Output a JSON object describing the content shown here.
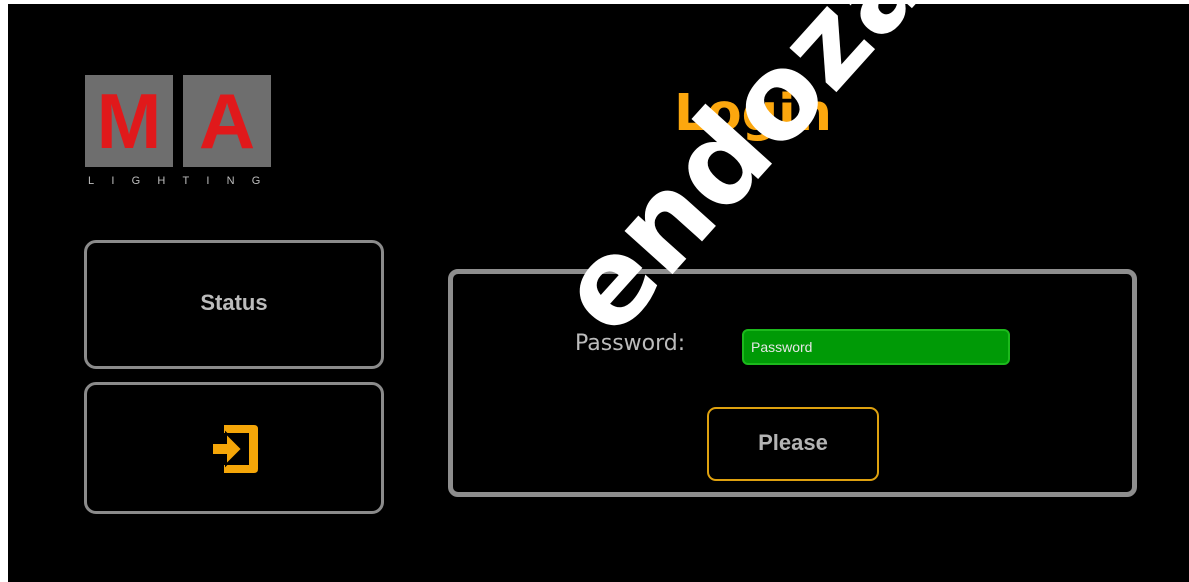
{
  "logo": {
    "letter_1": "M",
    "letter_2": "A",
    "subtitle": "LIGHTING",
    "colors": {
      "box": "#6e6e6e",
      "letters": "#e0191b"
    }
  },
  "header": {
    "title": "Login"
  },
  "sidebar": {
    "status_label": "Status",
    "login_icon": "login-arrow-icon"
  },
  "login_form": {
    "password_label": "Password:",
    "password_placeholder": "Password",
    "submit_label": "Please"
  },
  "watermark": {
    "text": "endoza.com.m"
  },
  "colors": {
    "accent": "#fca70e",
    "input_bg": "#009a06",
    "border": "#8e8e8e",
    "background": "#000000"
  }
}
